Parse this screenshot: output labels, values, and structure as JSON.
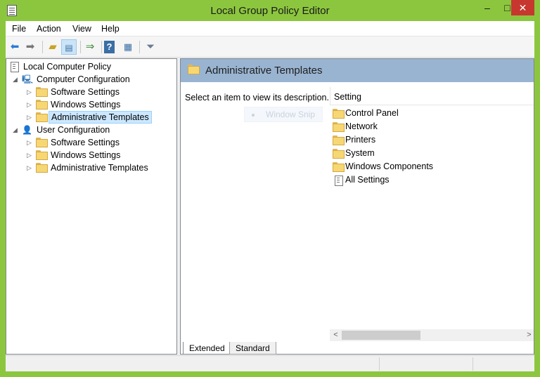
{
  "window": {
    "title": "Local Group Policy Editor",
    "controls": {
      "minimize": "–",
      "maximize": "□",
      "close": "✕"
    }
  },
  "menu": [
    "File",
    "Action",
    "View",
    "Help"
  ],
  "toolbar": {
    "icons": [
      "back-icon",
      "forward-icon",
      "up-folder-icon",
      "show-hide-tree-icon",
      "export-list-icon",
      "help-icon",
      "properties-icon",
      "filter-icon"
    ]
  },
  "tree": {
    "root": "Local Computer Policy",
    "computer": {
      "label": "Computer Configuration",
      "children": [
        "Software Settings",
        "Windows Settings",
        "Administrative Templates"
      ]
    },
    "user": {
      "label": "User Configuration",
      "children": [
        "Software Settings",
        "Windows Settings",
        "Administrative Templates"
      ]
    }
  },
  "right_pane": {
    "header_title": "Administrative Templates",
    "description": "Select an item to view its description.",
    "ghost_text": "Window Snip",
    "column_header": "Setting",
    "items": [
      "Control Panel",
      "Network",
      "Printers",
      "System",
      "Windows Components",
      "All Settings"
    ]
  },
  "tabs": [
    "Extended",
    "Standard"
  ],
  "colors": {
    "window_frame": "#8cc63f",
    "header_band": "#99b4d1",
    "selection": "#cce8ff",
    "close_button": "#c7372f"
  }
}
